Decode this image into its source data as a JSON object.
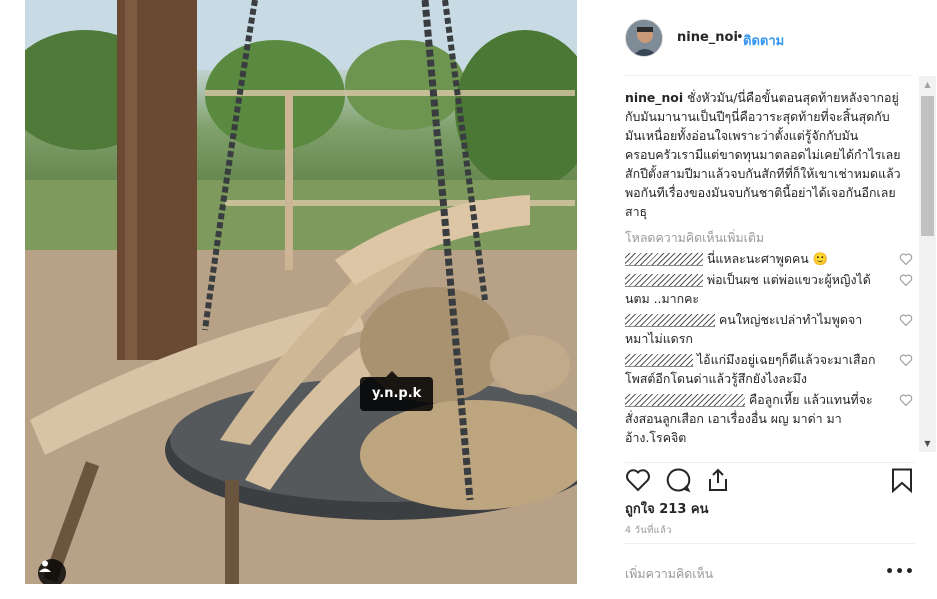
{
  "photo": {
    "tag_label": "y.n.p.k"
  },
  "post": {
    "username": "nine_noi",
    "dot": "•",
    "follow_label": "ติดตาม",
    "caption_user": "nine_noi",
    "caption": "ชั่งหัวมัน/นี่คือขั้นตอนสุดท้ายหลังจากอยู่กับมันมานานเป็นปีๆนี่คือวาระสุดท้ายที่จะสิ้นสุดกับมันเหนื่อยทั้งอ่อนใจเพราะว่าตั้งแต่รู้จักกับมันครอบครัวเรามีแต่ขาดทุนมาตลอดไม่เคยได้กำไรเลยสักปีตั้งสามปีมาแล้วจบกันสักทีที่ก็ให้เขาเช่าหมดแล้วพอกันทีเรื่องของมันจบกันชาตินี้อย่าได้เจอกันอีกเลยสาธุ",
    "load_more": "โหลดความคิดเห็นเพิ่มเติม",
    "comments": [
      {
        "text": "นี่แหละนะศาพูดคน 🙂"
      },
      {
        "text": "พ่อเป็นผช แต่พ่อแขวะผู้หญิงได้ นตม ..มากคะ"
      },
      {
        "text": "คนใหญ่ชะเปล่าทำไมพูดจาหมาไม่แดรก"
      },
      {
        "text": "ไอ้แก่มึงอยู่เฉยๆก็ดีแล้วจะมาเสือกโพสต์อีกโดนด่าแล้วรู้สึกยังไงละมึง"
      },
      {
        "text": "คือลูกเหี้ย แล้วแทนที่จะสั่งสอนลูกเสือก เอาเรื่องอื่น ผญ มาด่า มาอ้าง.โรคจิต"
      }
    ],
    "likes": "ถูกใจ 213 คน",
    "time": "4 วันที่แล้ว",
    "add_comment_placeholder": "เพิ่มความคิดเห็น",
    "more_label": "•••"
  },
  "icons": {
    "heart": "heart-icon",
    "comment": "comment-icon",
    "share": "share-icon",
    "save": "bookmark-icon",
    "user_tag": "user-icon"
  }
}
